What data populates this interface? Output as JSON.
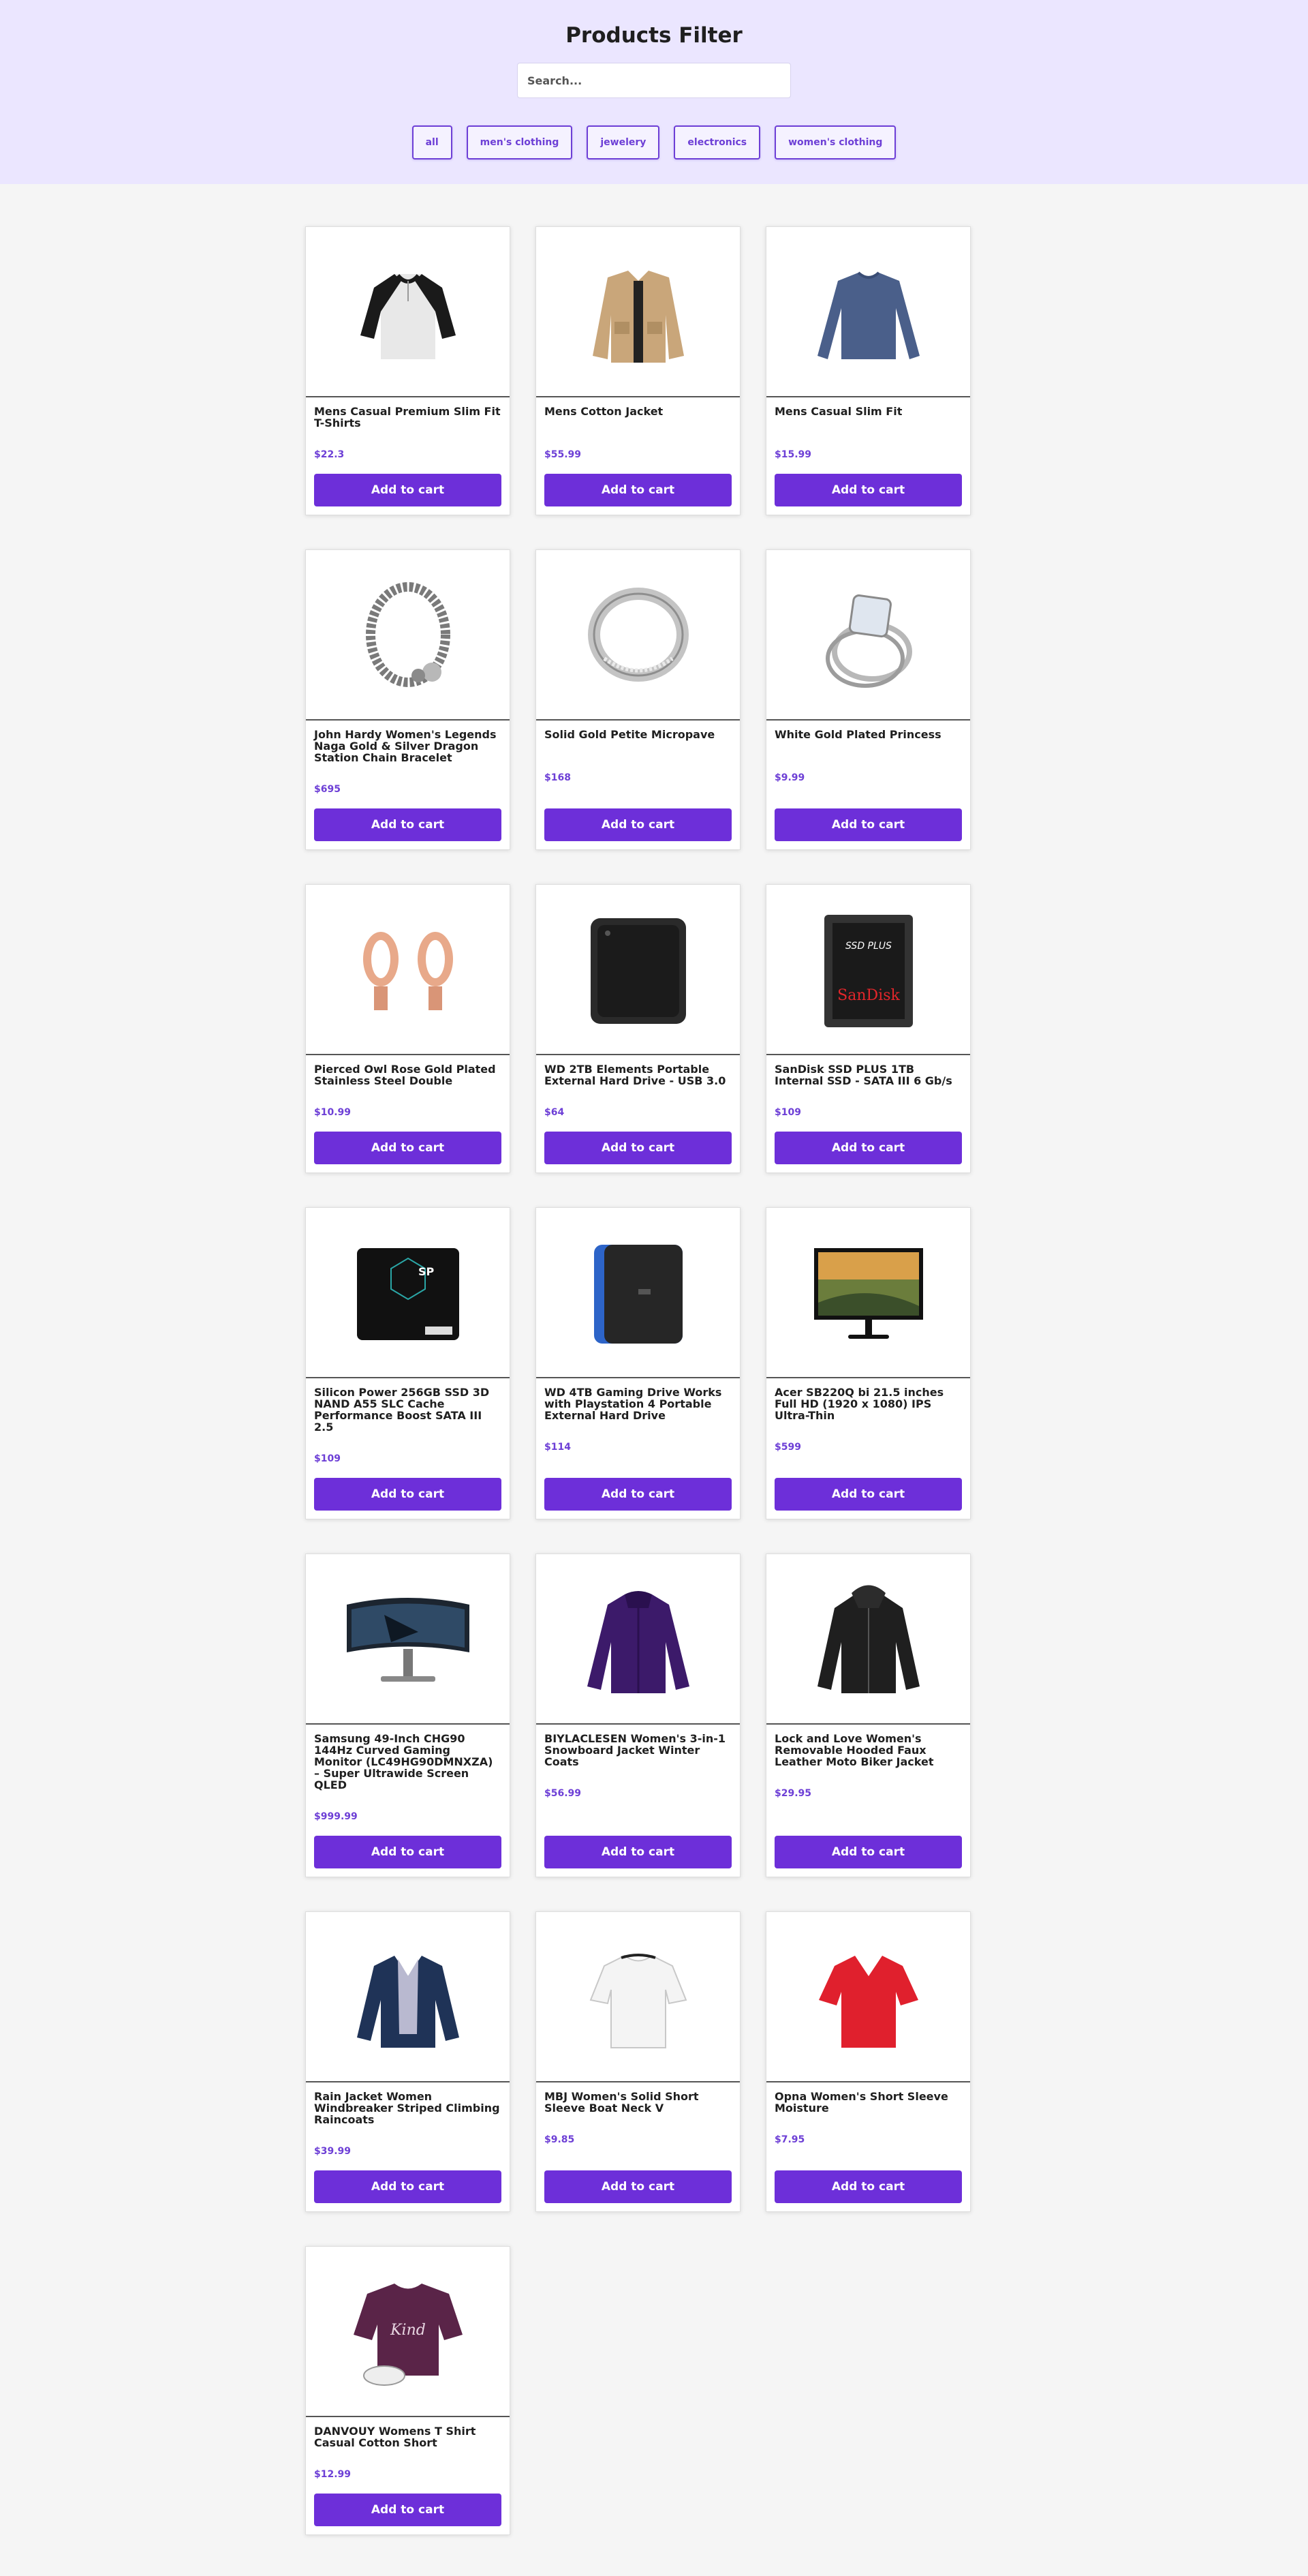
{
  "header": {
    "title": "Products Filter",
    "search_placeholder": "Search...",
    "filters": [
      "all",
      "men's clothing",
      "jewelery",
      "electronics",
      "women's clothing"
    ]
  },
  "colors": {
    "accent": "#6d2fd9",
    "header_bg": "#ebe6ff",
    "page_bg": "#f5f5f5"
  },
  "cart_label": "Add to cart",
  "products": [
    {
      "title": "Mens Casual Premium Slim Fit T-Shirts",
      "price": "$22.3",
      "icon": "raglan-shirt"
    },
    {
      "title": "Mens Cotton Jacket",
      "price": "$55.99",
      "icon": "tan-jacket"
    },
    {
      "title": "Mens Casual Slim Fit",
      "price": "$15.99",
      "icon": "blue-long-sleeve"
    },
    {
      "title": "John Hardy Women's Legends Naga Gold & Silver Dragon Station Chain Bracelet",
      "price": "$695",
      "icon": "bracelet"
    },
    {
      "title": "Solid Gold Petite Micropave",
      "price": "$168",
      "icon": "silver-ring"
    },
    {
      "title": "White Gold Plated Princess",
      "price": "$9.99",
      "icon": "diamond-ring"
    },
    {
      "title": "Pierced Owl Rose Gold Plated Stainless Steel Double",
      "price": "$10.99",
      "icon": "rose-gold-plugs"
    },
    {
      "title": "WD 2TB Elements Portable External Hard Drive - USB 3.0",
      "price": "$64",
      "icon": "hard-drive"
    },
    {
      "title": "SanDisk SSD PLUS 1TB Internal SSD - SATA III 6 Gb/s",
      "price": "$109",
      "icon": "sandisk-ssd"
    },
    {
      "title": "Silicon Power 256GB SSD 3D NAND A55 SLC Cache Performance Boost SATA III 2.5",
      "price": "$109",
      "icon": "silicon-power-ssd"
    },
    {
      "title": "WD 4TB Gaming Drive Works with Playstation 4 Portable External Hard Drive",
      "price": "$114",
      "icon": "gaming-drive"
    },
    {
      "title": "Acer SB220Q bi 21.5 inches Full HD (1920 x 1080) IPS Ultra-Thin",
      "price": "$599",
      "icon": "monitor"
    },
    {
      "title": "Samsung 49-Inch CHG90 144Hz Curved Gaming Monitor (LC49HG90DMNXZA) – Super Ultrawide Screen QLED",
      "price": "$999.99",
      "icon": "curved-monitor"
    },
    {
      "title": "BIYLACLESEN Women's 3-in-1 Snowboard Jacket Winter Coats",
      "price": "$56.99",
      "icon": "purple-jacket"
    },
    {
      "title": "Lock and Love Women's Removable Hooded Faux Leather Moto Biker Jacket",
      "price": "$29.95",
      "icon": "leather-jacket"
    },
    {
      "title": "Rain Jacket Women Windbreaker Striped Climbing Raincoats",
      "price": "$39.99",
      "icon": "navy-blazer"
    },
    {
      "title": "MBJ Women's Solid Short Sleeve Boat Neck V",
      "price": "$9.85",
      "icon": "white-top"
    },
    {
      "title": "Opna Women's Short Sleeve Moisture",
      "price": "$7.95",
      "icon": "red-tshirt"
    },
    {
      "title": "DANVOUY Womens T Shirt Casual Cotton Short",
      "price": "$12.99",
      "icon": "plum-tshirt"
    }
  ]
}
